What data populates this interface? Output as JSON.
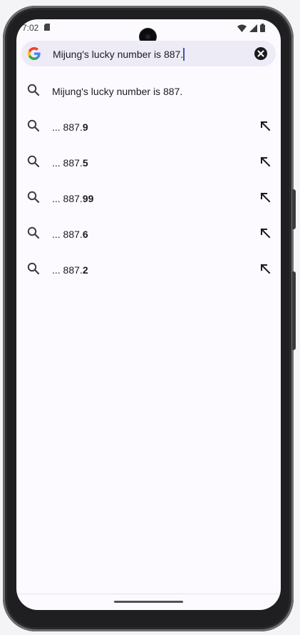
{
  "status_bar": {
    "time": "7:02",
    "icons": [
      "sd-card-icon",
      "wifi-icon",
      "cellular-signal-icon",
      "battery-icon"
    ]
  },
  "search": {
    "query": "Mijung's lucky number is 887.",
    "logo": "google-logo",
    "clear_icon": "clear-icon"
  },
  "suggestions": [
    {
      "prefix": "Mijung's lucky number is 887.",
      "bold": "",
      "has_arrow": false
    },
    {
      "prefix": "... 887.",
      "bold": "9",
      "has_arrow": true
    },
    {
      "prefix": "... 887.",
      "bold": "5",
      "has_arrow": true
    },
    {
      "prefix": "... 887.",
      "bold": "99",
      "has_arrow": true
    },
    {
      "prefix": "... 887.",
      "bold": "6",
      "has_arrow": true
    },
    {
      "prefix": "... 887.",
      "bold": "2",
      "has_arrow": true
    }
  ],
  "colors": {
    "screen_bg": "#fcfaff",
    "search_bg": "#edebf5",
    "text": "#1b1b1f",
    "caret": "#3d56a8"
  }
}
